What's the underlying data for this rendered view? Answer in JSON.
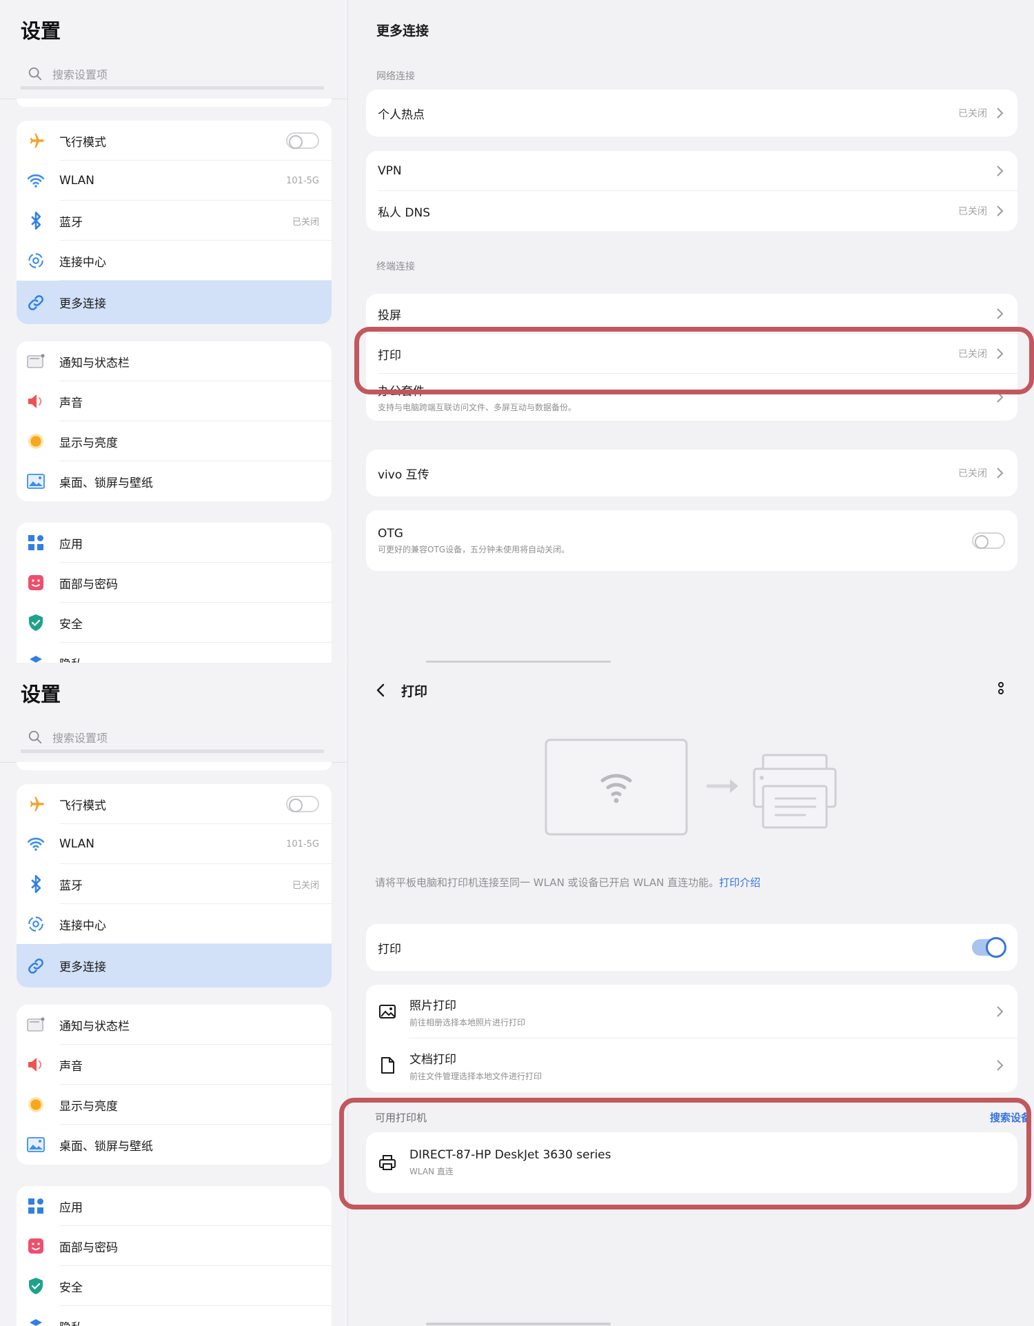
{
  "sidebar": {
    "title": "设置",
    "search_placeholder": "搜索设置项",
    "group1": [
      {
        "label": "飞行模式",
        "value": ""
      },
      {
        "label": "WLAN",
        "value": "101-5G"
      },
      {
        "label": "蓝牙",
        "value": "已关闭"
      },
      {
        "label": "连接中心",
        "value": ""
      },
      {
        "label": "更多连接",
        "value": ""
      }
    ],
    "group2": [
      {
        "label": "通知与状态栏"
      },
      {
        "label": "声音"
      },
      {
        "label": "显示与亮度"
      },
      {
        "label": "桌面、锁屏与壁纸"
      }
    ],
    "group3": [
      {
        "label": "应用"
      },
      {
        "label": "面部与密码"
      },
      {
        "label": "安全"
      },
      {
        "label": "隐私"
      }
    ]
  },
  "more": {
    "title": "更多连接",
    "section_network": "网络连接",
    "hotspot": {
      "label": "个人热点",
      "value": "已关闭"
    },
    "vpn": {
      "label": "VPN"
    },
    "dns": {
      "label": "私人 DNS",
      "value": "已关闭"
    },
    "section_terminal": "终端连接",
    "cast": {
      "label": "投屏"
    },
    "print": {
      "label": "打印",
      "value": "已关闭"
    },
    "office": {
      "label": "办公套件",
      "sub": "支持与电脑跨端互联访问文件、多屏互动与数据备份。"
    },
    "vivo": {
      "label": "vivo 互传",
      "value": "已关闭"
    },
    "otg": {
      "label": "OTG",
      "sub": "可更好的兼容OTG设备，五分钟未使用将自动关闭。"
    }
  },
  "print_page": {
    "title": "打印",
    "description": "请将平板电脑和打印机连接至同一 WLAN 或设备已开启 WLAN 直连功能。",
    "intro_link": "打印介绍",
    "toggle_label": "打印",
    "photo": {
      "label": "照片打印",
      "sub": "前往相册选择本地照片进行打印"
    },
    "doc": {
      "label": "文档打印",
      "sub": "前往文件管理选择本地文件进行打印"
    },
    "available_label": "可用打印机",
    "search_devices": "搜索设备",
    "printer": {
      "label": "DIRECT-87-HP DeskJet 3630 series",
      "sub": "WLAN 直连"
    }
  },
  "colors": {
    "accent": "#3674e0",
    "highlight": "#c2575d",
    "active_bg": "#d2e1f7"
  }
}
